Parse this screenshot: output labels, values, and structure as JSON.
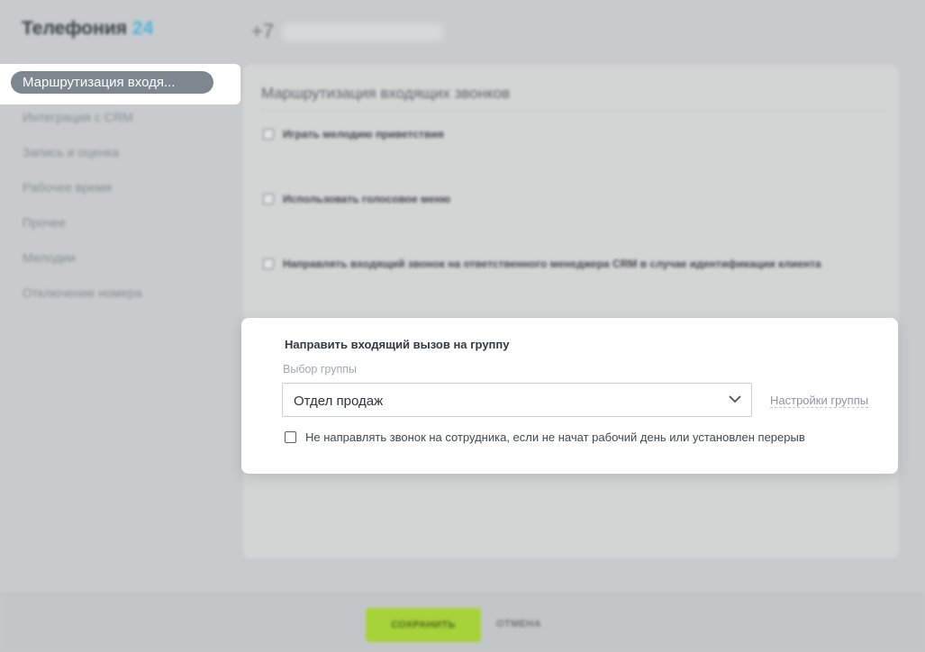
{
  "brand": {
    "name": "Телефония",
    "number": "24"
  },
  "header": {
    "phone_prefix": "+7"
  },
  "sidebar": {
    "active_label": "Маршрутизация входя...",
    "items": [
      {
        "label": "Интеграция с CRM"
      },
      {
        "label": "Запись и оценка"
      },
      {
        "label": "Рабочее время"
      },
      {
        "label": "Прочее"
      },
      {
        "label": "Мелодии"
      },
      {
        "label": "Отключение номера"
      }
    ]
  },
  "main": {
    "title": "Маршрутизация входящих звонков",
    "options": [
      {
        "label": "Играть мелодию приветствия",
        "checked": false
      },
      {
        "label": "Использовать голосовое меню",
        "checked": false
      },
      {
        "label": "Направлять входящий звонок на ответственного менеджера CRM в случае идентификации клиента",
        "checked": false
      }
    ]
  },
  "group_panel": {
    "title": "Направить входящий вызов на группу",
    "select_label": "Выбор группы",
    "selected_group": "Отдел продаж",
    "settings_link": "Настройки группы",
    "skip_checkbox_label": "Не направлять звонок на сотрудника, если не начат рабочий день или установлен перерыв",
    "skip_checked": false
  },
  "footer": {
    "save_label": "СОХРАНИТЬ",
    "cancel_label": "ОТМЕНА"
  },
  "colors": {
    "brand_accent": "#4fb3d9",
    "save_button": "#a6d33a",
    "active_nav": "#7e878f",
    "overlay_bg": "#c7cbcd"
  }
}
